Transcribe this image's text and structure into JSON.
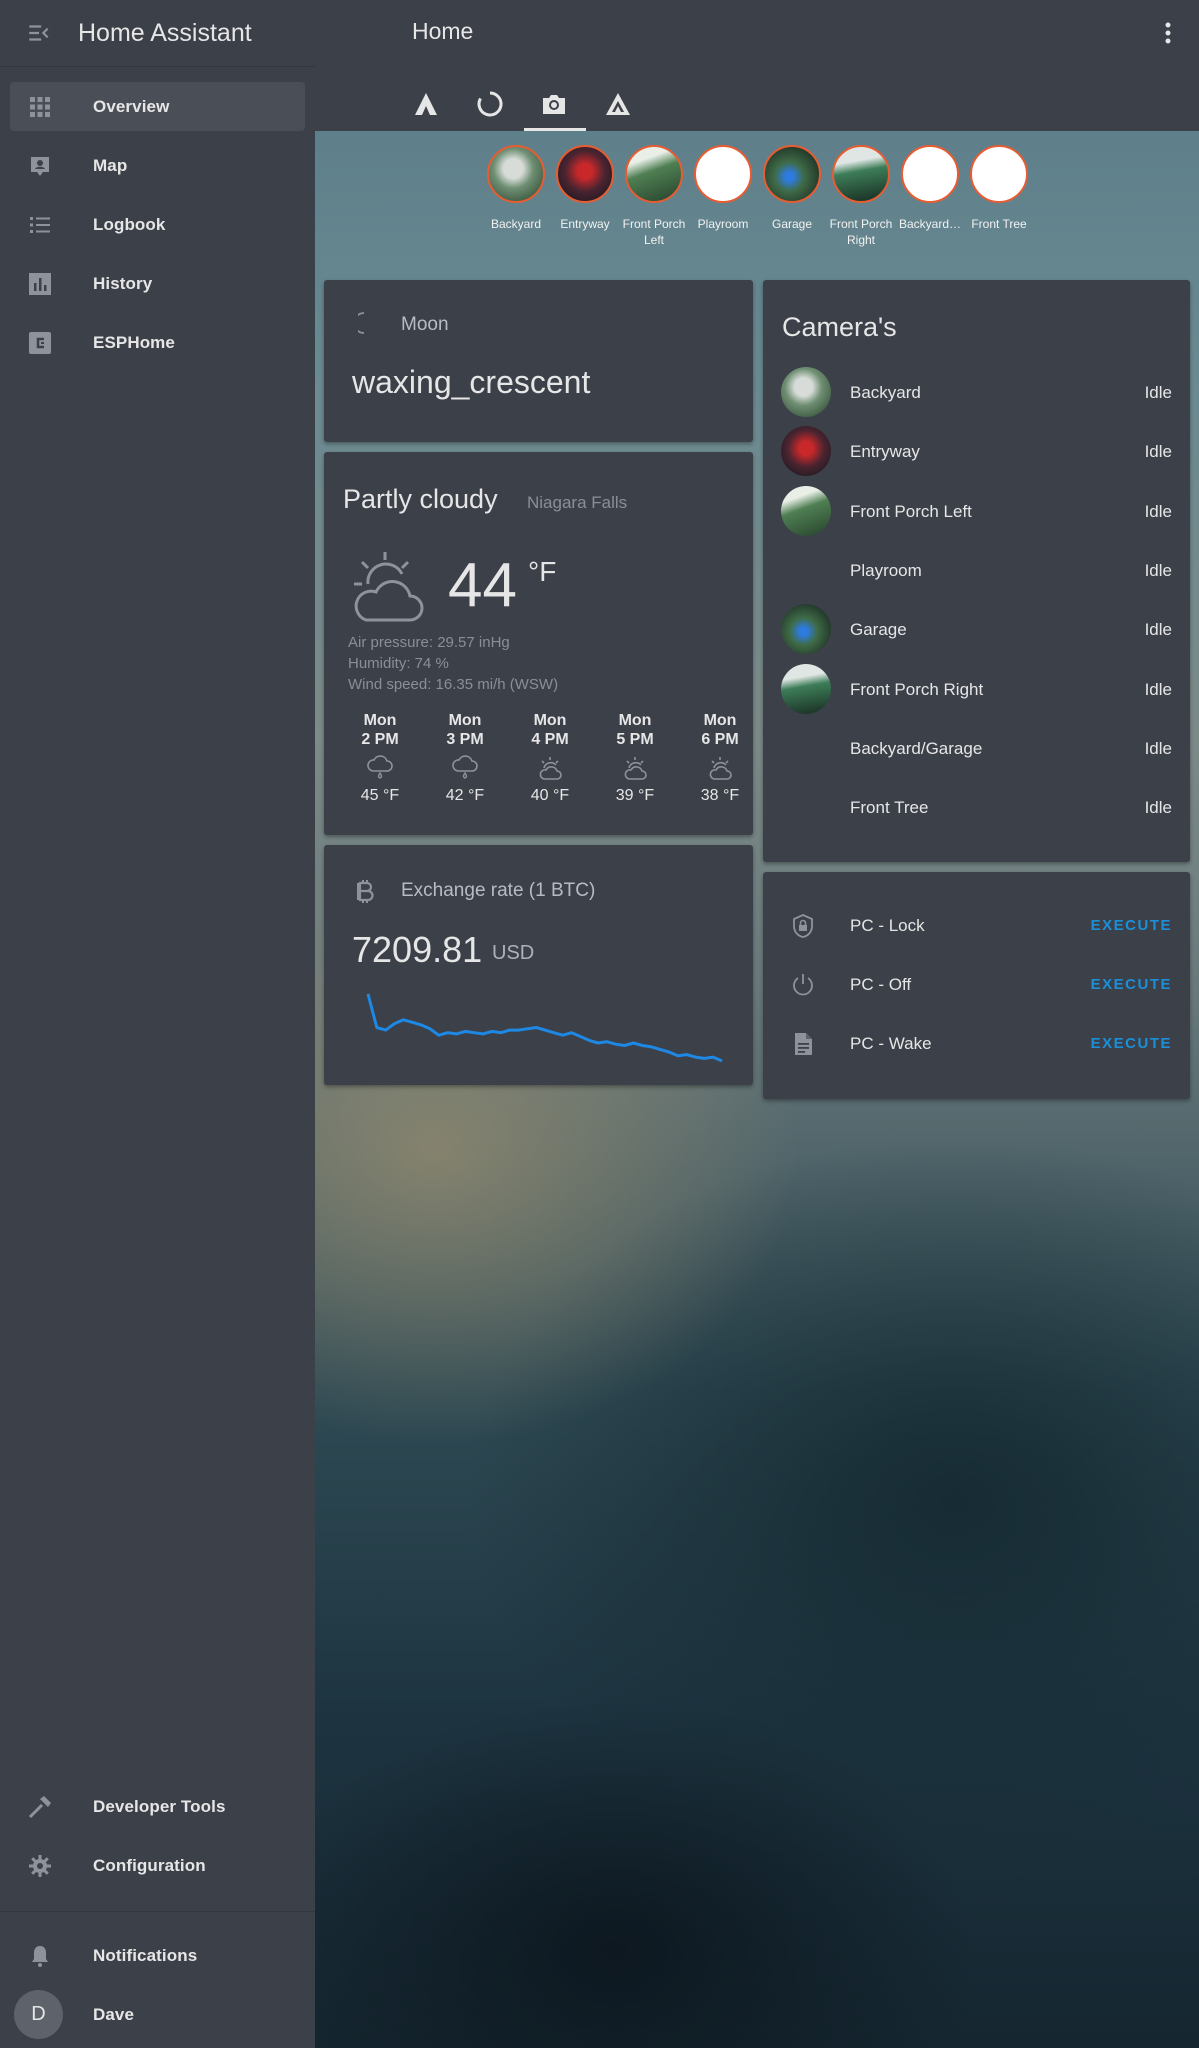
{
  "sidebar": {
    "title": "Home Assistant",
    "items": [
      {
        "label": "Overview",
        "icon": "grid-icon"
      },
      {
        "label": "Map",
        "icon": "map-icon"
      },
      {
        "label": "Logbook",
        "icon": "list-icon"
      },
      {
        "label": "History",
        "icon": "chart-icon"
      },
      {
        "label": "ESPHome",
        "icon": "esphome-icon"
      }
    ],
    "bottom_items": [
      {
        "label": "Developer Tools",
        "icon": "hammer-icon"
      },
      {
        "label": "Configuration",
        "icon": "gear-icon"
      }
    ],
    "notifications_label": "Notifications",
    "user": {
      "initial": "D",
      "name": "Dave"
    }
  },
  "header": {
    "title": "Home",
    "tabs": [
      "triangle-icon",
      "circle-icon",
      "camera-icon",
      "shapes-icon"
    ],
    "active_tab": 2
  },
  "camera_strip": [
    {
      "label": "Backyard",
      "has_image": true
    },
    {
      "label": "Entryway",
      "has_image": true
    },
    {
      "label": "Front Porch Left",
      "has_image": true
    },
    {
      "label": "Playroom",
      "has_image": false
    },
    {
      "label": "Garage",
      "has_image": true
    },
    {
      "label": "Front Porch Right",
      "has_image": true
    },
    {
      "label": "Backyard…",
      "has_image": false
    },
    {
      "label": "Front Tree",
      "has_image": false
    }
  ],
  "moon": {
    "label": "Moon",
    "state": "waxing_crescent"
  },
  "weather": {
    "condition": "Partly cloudy",
    "location": "Niagara Falls",
    "temperature": "44",
    "unit": "°F",
    "air_pressure": "Air pressure: 29.57 inHg",
    "humidity": "Humidity: 74 %",
    "wind": "Wind speed: 16.35 mi/h (WSW)",
    "forecast": [
      {
        "day": "Mon",
        "time": "2 PM",
        "temp": "45 °F",
        "icon": "rain-cloud-icon"
      },
      {
        "day": "Mon",
        "time": "3 PM",
        "temp": "42 °F",
        "icon": "rain-cloud-icon"
      },
      {
        "day": "Mon",
        "time": "4 PM",
        "temp": "40 °F",
        "icon": "night-partly-cloudy-icon"
      },
      {
        "day": "Mon",
        "time": "5 PM",
        "temp": "39 °F",
        "icon": "night-partly-cloudy-icon"
      },
      {
        "day": "Mon",
        "time": "6 PM",
        "temp": "38 °F",
        "icon": "night-partly-cloudy-icon"
      }
    ]
  },
  "btc": {
    "title": "Exchange rate (1 BTC)",
    "value": "7209.81",
    "unit": "USD",
    "sparkline": [
      8.8,
      6.2,
      6.0,
      6.5,
      6.8,
      6.6,
      6.4,
      6.1,
      5.6,
      5.8,
      5.7,
      5.9,
      5.8,
      5.7,
      5.9,
      5.8,
      6.0,
      6.0,
      6.1,
      6.2,
      6.0,
      5.8,
      5.6,
      5.8,
      5.5,
      5.2,
      5.0,
      5.1,
      4.9,
      4.8,
      5.0,
      4.8,
      4.7,
      4.5,
      4.3,
      4.0,
      4.1,
      3.9,
      3.8,
      3.9,
      3.6
    ],
    "line_color": "#1e88e5"
  },
  "cameras_card": {
    "title": "Camera's",
    "rows": [
      {
        "name": "Backyard",
        "state": "Idle",
        "has_image": true
      },
      {
        "name": "Entryway",
        "state": "Idle",
        "has_image": true
      },
      {
        "name": "Front Porch Left",
        "state": "Idle",
        "has_image": true
      },
      {
        "name": "Playroom",
        "state": "Idle",
        "has_image": false
      },
      {
        "name": "Garage",
        "state": "Idle",
        "has_image": true
      },
      {
        "name": "Front Porch Right",
        "state": "Idle",
        "has_image": true
      },
      {
        "name": "Backyard/Garage",
        "state": "Idle",
        "has_image": false
      },
      {
        "name": "Front Tree",
        "state": "Idle",
        "has_image": false
      }
    ]
  },
  "scripts_card": {
    "rows": [
      {
        "name": "PC - Lock",
        "action": "EXECUTE",
        "icon": "shield-lock-icon"
      },
      {
        "name": "PC - Off",
        "action": "EXECUTE",
        "icon": "power-icon"
      },
      {
        "name": "PC - Wake",
        "action": "EXECUTE",
        "icon": "document-icon"
      }
    ]
  },
  "colors": {
    "accent": "#1b8fd8",
    "camera_ring": "#e85c32",
    "sidebar_bg": "#3c4048",
    "card_bg": "#3c4049"
  }
}
